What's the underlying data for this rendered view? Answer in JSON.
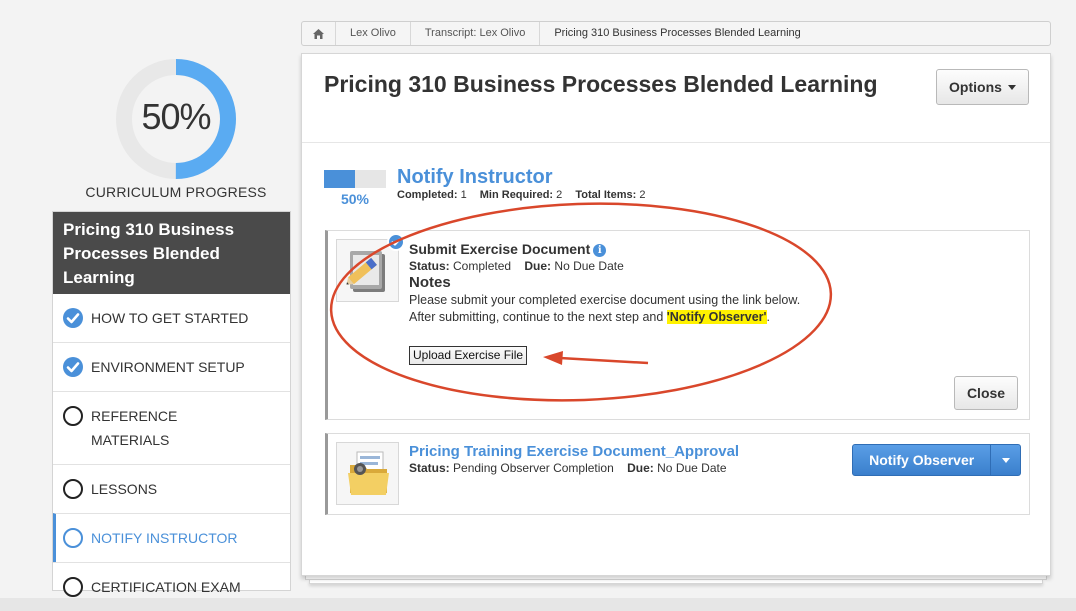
{
  "progress": {
    "percent_text": "50%",
    "fraction": 0.5,
    "caption": "CURRICULUM PROGRESS"
  },
  "curriculum": {
    "title": "Pricing 310 Business Processes Blended Learning",
    "steps": [
      {
        "label": "HOW TO GET STARTED",
        "state": "done"
      },
      {
        "label": "ENVIRONMENT SETUP",
        "state": "done"
      },
      {
        "label": "REFERENCE MATERIALS",
        "state": "open"
      },
      {
        "label": "LESSONS",
        "state": "open"
      },
      {
        "label": "NOTIFY INSTRUCTOR",
        "state": "active"
      },
      {
        "label": "CERTIFICATION EXAM",
        "state": "open"
      }
    ]
  },
  "breadcrumb": {
    "items": [
      "Lex Olivo",
      "Transcript: Lex Olivo",
      "Pricing 310 Business Processes Blended Learning"
    ]
  },
  "panel": {
    "title": "Pricing 310 Business Processes Blended Learning",
    "options_label": "Options"
  },
  "step": {
    "name": "Notify Instructor",
    "percent_text": "50%",
    "fraction": 0.5,
    "completed_label": "Completed:",
    "completed_value": "1",
    "min_required_label": "Min Required:",
    "min_required_value": "2",
    "total_items_label": "Total Items:",
    "total_items_value": "2"
  },
  "item1": {
    "title": "Submit Exercise Document",
    "status_label": "Status:",
    "status_value": "Completed",
    "due_label": "Due:",
    "due_value": "No Due Date",
    "notes_heading": "Notes",
    "notes_line1": "Please submit your completed exercise document using the link below.",
    "notes_line2_prefix": "After submitting, continue to the next step and ",
    "notes_line2_highlight": "'Notify Observer'",
    "notes_line2_suffix": ".",
    "upload_label": "Upload Exercise File",
    "close_label": "Close"
  },
  "item2": {
    "title": "Pricing Training Exercise Document_Approval",
    "status_label": "Status:",
    "status_value": "Pending Observer Completion",
    "due_label": "Due:",
    "due_value": "No Due Date",
    "notify_label": "Notify Observer"
  },
  "colors": {
    "accent": "#4a90d9",
    "annotation": "#d9472b",
    "highlight": "#fff200",
    "header_dark": "#4a4a4a"
  }
}
